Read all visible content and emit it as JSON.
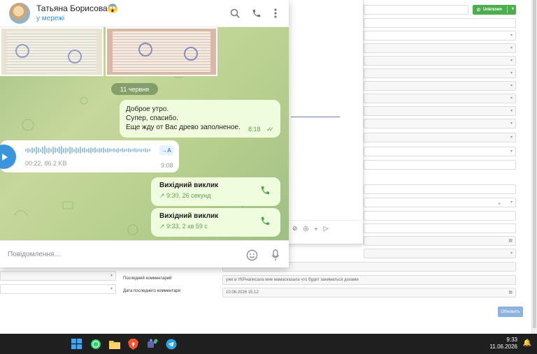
{
  "telegram": {
    "contact_name": "Татьяна Борисова",
    "contact_emoji": "😱",
    "status": "у мережі",
    "date_separator": "11 червня",
    "messages": {
      "outgoing_text": {
        "lines": [
          "Доброе утро.",
          "Супер, спасибо.",
          "Еще жду от Вас древо заполненое."
        ],
        "time": "8:18"
      },
      "voice": {
        "meta": "00:22, 86.2 KB",
        "time": "9:08",
        "transcribe_label": "→A"
      },
      "calls": [
        {
          "title": "Вихідний виклик",
          "detail": "9:30, 26 секунд"
        },
        {
          "title": "Вихідний виклик",
          "detail": "9:33, 2 хв 59 с"
        }
      ]
    },
    "input_placeholder": "Повідомлення...",
    "icons": {
      "search": "search-icon",
      "call": "phone-icon",
      "menu": "more-vertical-icon",
      "emoji": "emoji-icon",
      "mic": "microphone-icon"
    }
  },
  "crm": {
    "unknown_button": "Unknown",
    "fields": {
      "last_comment_label": "Последний комментарий",
      "last_comment_value": "уже в УКРнаписала мне мамасказала что будет заниматься дохами",
      "last_comment_date_label": "Дата последнего комментаря",
      "last_comment_date_value": "10.06.2026 15:12"
    },
    "refresh_button": "Обновить"
  },
  "taskbar": {
    "time": "9:33",
    "date": "11.06.2026"
  },
  "colors": {
    "accent_blue": "#3a95dd",
    "bubble_out": "#effdde",
    "time_green": "#5fa04b",
    "unknown_green": "#4cae4c",
    "taskbar": "#1f1f1f"
  }
}
